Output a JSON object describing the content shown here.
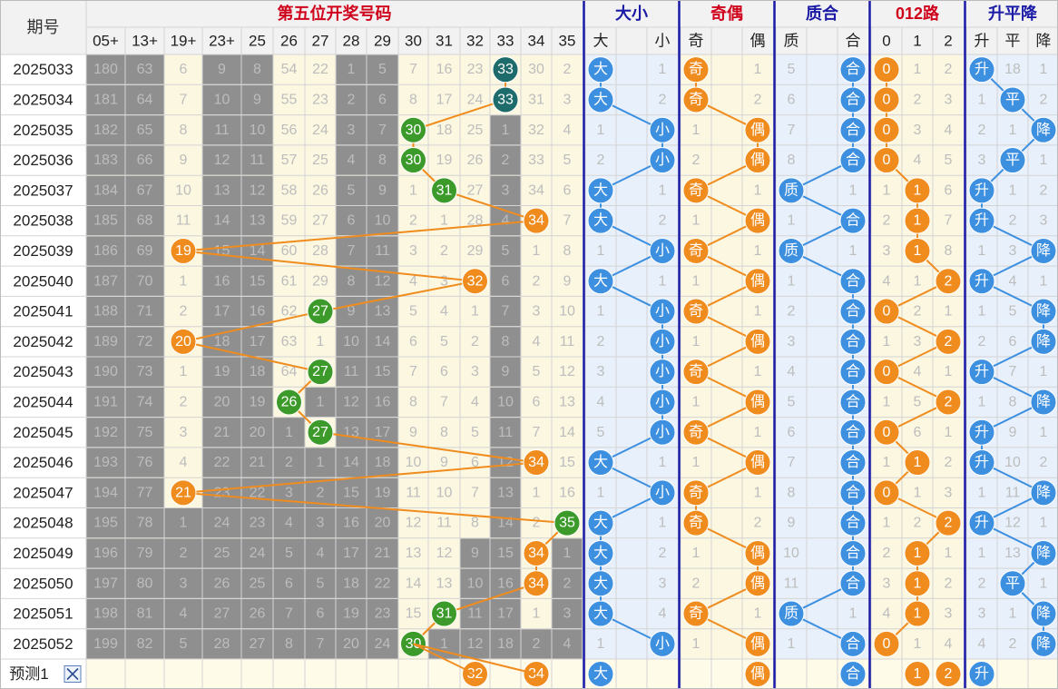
{
  "header": {
    "period_label": "期号",
    "groups": [
      {
        "key": "fifth",
        "label": "第五位开奖号码",
        "color": "#d0021b"
      },
      {
        "key": "bigsmall",
        "label": "大小",
        "color": "#1a1aa6"
      },
      {
        "key": "oddeven",
        "label": "奇偶",
        "color": "#d0021b"
      },
      {
        "key": "primecomp",
        "label": "质合",
        "color": "#1a1aa6"
      },
      {
        "key": "route012",
        "label": "012路",
        "color": "#d0021b"
      },
      {
        "key": "trend",
        "label": "升平降",
        "color": "#1a1aa6"
      }
    ],
    "sub": {
      "fifth": [
        "05+",
        "13+",
        "19+",
        "23+",
        "25",
        "26",
        "27",
        "28",
        "29",
        "30",
        "31",
        "32",
        "33",
        "34",
        "35"
      ],
      "bigsmall": [
        "大",
        "",
        "小"
      ],
      "oddeven": [
        "奇",
        "",
        "偶"
      ],
      "primecomp": [
        "质",
        "",
        "合"
      ],
      "route012": [
        "0",
        "1",
        "2"
      ],
      "trend": [
        "升",
        "平",
        "降"
      ]
    }
  },
  "colors": {
    "blue": "#3d8fe0",
    "orange": "#f08c1e",
    "green": "#3c9a2a",
    "teal": "#1d6b6b",
    "grey": "#8f8f8f",
    "cream": "#fbf7e0",
    "lightblue": "#e8f1fb",
    "line_blue": "#3d8fe0",
    "line_orange": "#f08c1e"
  },
  "footer": {
    "label": "预测1",
    "close_icon": "close-icon"
  },
  "chart_data": {
    "type": "table",
    "columns": [
      "期号",
      "05+",
      "13+",
      "19+",
      "23+",
      "25",
      "26",
      "27",
      "28",
      "29",
      "30",
      "31",
      "32",
      "33",
      "34",
      "35",
      "大",
      "小",
      "奇",
      "偶",
      "质",
      "合",
      "0",
      "1",
      "2",
      "升",
      "平",
      "降"
    ],
    "rows": [
      {
        "period": "2025033",
        "num": 33,
        "cells": [
          "180",
          "63",
          "6",
          "9",
          "8",
          "54",
          "22",
          "1",
          "5",
          "7",
          "16",
          "23",
          "33",
          "30",
          "2"
        ],
        "bs": [
          "大",
          "",
          "1"
        ],
        "oe": [
          "奇",
          "",
          "1"
        ],
        "pc": [
          "5",
          "",
          "合"
        ],
        "r": [
          "0",
          "1",
          "2"
        ],
        "t": [
          "升",
          "18",
          "1"
        ]
      },
      {
        "period": "2025034",
        "num": 33,
        "cells": [
          "181",
          "64",
          "7",
          "10",
          "9",
          "55",
          "23",
          "2",
          "6",
          "8",
          "17",
          "24",
          "33",
          "31",
          "3"
        ],
        "bs": [
          "大",
          "",
          "2"
        ],
        "oe": [
          "奇",
          "",
          "2"
        ],
        "pc": [
          "6",
          "",
          "合"
        ],
        "r": [
          "0",
          "2",
          "3"
        ],
        "t": [
          "1",
          "平",
          "2"
        ]
      },
      {
        "period": "2025035",
        "num": 30,
        "cells": [
          "182",
          "65",
          "8",
          "11",
          "10",
          "56",
          "24",
          "3",
          "7",
          "30",
          "18",
          "25",
          "1",
          "32",
          "4"
        ],
        "bs": [
          "1",
          "",
          "小"
        ],
        "oe": [
          "1",
          "",
          "偶"
        ],
        "pc": [
          "7",
          "",
          "合"
        ],
        "r": [
          "0",
          "3",
          "4"
        ],
        "t": [
          "2",
          "1",
          "降"
        ]
      },
      {
        "period": "2025036",
        "num": 30,
        "cells": [
          "183",
          "66",
          "9",
          "12",
          "11",
          "57",
          "25",
          "4",
          "8",
          "30",
          "19",
          "26",
          "2",
          "33",
          "5"
        ],
        "bs": [
          "2",
          "",
          "小"
        ],
        "oe": [
          "2",
          "",
          "偶"
        ],
        "pc": [
          "8",
          "",
          "合"
        ],
        "r": [
          "0",
          "4",
          "5"
        ],
        "t": [
          "3",
          "平",
          "1"
        ]
      },
      {
        "period": "2025037",
        "num": 31,
        "cells": [
          "184",
          "67",
          "10",
          "13",
          "12",
          "58",
          "26",
          "5",
          "9",
          "1",
          "31",
          "27",
          "3",
          "34",
          "6"
        ],
        "bs": [
          "大",
          "",
          "1"
        ],
        "oe": [
          "奇",
          "",
          "1"
        ],
        "pc": [
          "质",
          "",
          "1"
        ],
        "r": [
          "1",
          "1",
          "6"
        ],
        "t": [
          "升",
          "1",
          "2"
        ]
      },
      {
        "period": "2025038",
        "num": 34,
        "cells": [
          "185",
          "68",
          "11",
          "14",
          "13",
          "59",
          "27",
          "6",
          "10",
          "2",
          "1",
          "28",
          "4",
          "34",
          "7"
        ],
        "bs": [
          "大",
          "",
          "2"
        ],
        "oe": [
          "1",
          "",
          "偶"
        ],
        "pc": [
          "1",
          "",
          "合"
        ],
        "r": [
          "2",
          "1",
          "7"
        ],
        "t": [
          "升",
          "2",
          "3"
        ]
      },
      {
        "period": "2025039",
        "num": 19,
        "cells": [
          "186",
          "69",
          "19",
          "15",
          "14",
          "60",
          "28",
          "7",
          "11",
          "3",
          "2",
          "29",
          "5",
          "1",
          "8"
        ],
        "bs": [
          "1",
          "",
          "小"
        ],
        "oe": [
          "奇",
          "",
          "1"
        ],
        "pc": [
          "质",
          "",
          "1"
        ],
        "r": [
          "3",
          "1",
          "8"
        ],
        "t": [
          "1",
          "3",
          "降"
        ]
      },
      {
        "period": "2025040",
        "num": 32,
        "cells": [
          "187",
          "70",
          "1",
          "16",
          "15",
          "61",
          "29",
          "8",
          "12",
          "4",
          "3",
          "32",
          "6",
          "2",
          "9"
        ],
        "bs": [
          "大",
          "",
          "1"
        ],
        "oe": [
          "1",
          "",
          "偶"
        ],
        "pc": [
          "1",
          "",
          "合"
        ],
        "r": [
          "4",
          "1",
          "2"
        ],
        "t": [
          "升",
          "4",
          "1"
        ]
      },
      {
        "period": "2025041",
        "num": 27,
        "cells": [
          "188",
          "71",
          "2",
          "17",
          "16",
          "62",
          "27",
          "9",
          "13",
          "5",
          "4",
          "1",
          "7",
          "3",
          "10"
        ],
        "bs": [
          "1",
          "",
          "小"
        ],
        "oe": [
          "奇",
          "",
          "1"
        ],
        "pc": [
          "2",
          "",
          "合"
        ],
        "r": [
          "0",
          "2",
          "1"
        ],
        "t": [
          "1",
          "5",
          "降"
        ]
      },
      {
        "period": "2025042",
        "num": 20,
        "cells": [
          "189",
          "72",
          "20",
          "18",
          "17",
          "63",
          "1",
          "10",
          "14",
          "6",
          "5",
          "2",
          "8",
          "4",
          "11"
        ],
        "bs": [
          "2",
          "",
          "小"
        ],
        "oe": [
          "1",
          "",
          "偶"
        ],
        "pc": [
          "3",
          "",
          "合"
        ],
        "r": [
          "1",
          "3",
          "2"
        ],
        "t": [
          "2",
          "6",
          "降"
        ]
      },
      {
        "period": "2025043",
        "num": 27,
        "cells": [
          "190",
          "73",
          "1",
          "19",
          "18",
          "64",
          "27",
          "11",
          "15",
          "7",
          "6",
          "3",
          "9",
          "5",
          "12"
        ],
        "bs": [
          "3",
          "",
          "小"
        ],
        "oe": [
          "奇",
          "",
          "1"
        ],
        "pc": [
          "4",
          "",
          "合"
        ],
        "r": [
          "0",
          "4",
          "1"
        ],
        "t": [
          "升",
          "7",
          "1"
        ]
      },
      {
        "period": "2025044",
        "num": 26,
        "cells": [
          "191",
          "74",
          "2",
          "20",
          "19",
          "26",
          "1",
          "12",
          "16",
          "8",
          "7",
          "4",
          "10",
          "6",
          "13"
        ],
        "bs": [
          "4",
          "",
          "小"
        ],
        "oe": [
          "1",
          "",
          "偶"
        ],
        "pc": [
          "5",
          "",
          "合"
        ],
        "r": [
          "1",
          "5",
          "2"
        ],
        "t": [
          "1",
          "8",
          "降"
        ]
      },
      {
        "period": "2025045",
        "num": 27,
        "cells": [
          "192",
          "75",
          "3",
          "21",
          "20",
          "1",
          "27",
          "13",
          "17",
          "9",
          "8",
          "5",
          "11",
          "7",
          "14"
        ],
        "bs": [
          "5",
          "",
          "小"
        ],
        "oe": [
          "奇",
          "",
          "1"
        ],
        "pc": [
          "6",
          "",
          "合"
        ],
        "r": [
          "0",
          "6",
          "1"
        ],
        "t": [
          "升",
          "9",
          "1"
        ]
      },
      {
        "period": "2025046",
        "num": 34,
        "cells": [
          "193",
          "76",
          "4",
          "22",
          "21",
          "2",
          "1",
          "14",
          "18",
          "10",
          "9",
          "6",
          "12",
          "34",
          "15"
        ],
        "bs": [
          "大",
          "",
          "1"
        ],
        "oe": [
          "1",
          "",
          "偶"
        ],
        "pc": [
          "7",
          "",
          "合"
        ],
        "r": [
          "1",
          "1",
          "2"
        ],
        "t": [
          "升",
          "10",
          "2"
        ]
      },
      {
        "period": "2025047",
        "num": 21,
        "cells": [
          "194",
          "77",
          "21",
          "23",
          "22",
          "3",
          "2",
          "15",
          "19",
          "11",
          "10",
          "7",
          "13",
          "1",
          "16"
        ],
        "bs": [
          "1",
          "",
          "小"
        ],
        "oe": [
          "奇",
          "",
          "1"
        ],
        "pc": [
          "8",
          "",
          "合"
        ],
        "r": [
          "0",
          "1",
          "3"
        ],
        "t": [
          "1",
          "11",
          "降"
        ]
      },
      {
        "period": "2025048",
        "num": 35,
        "cells": [
          "195",
          "78",
          "1",
          "24",
          "23",
          "4",
          "3",
          "16",
          "20",
          "12",
          "11",
          "8",
          "14",
          "2",
          "35"
        ],
        "bs": [
          "大",
          "",
          "1"
        ],
        "oe": [
          "奇",
          "",
          "2"
        ],
        "pc": [
          "9",
          "",
          "合"
        ],
        "r": [
          "1",
          "2",
          "2"
        ],
        "t": [
          "升",
          "12",
          "1"
        ]
      },
      {
        "period": "2025049",
        "num": 34,
        "cells": [
          "196",
          "79",
          "2",
          "25",
          "24",
          "5",
          "4",
          "17",
          "21",
          "13",
          "12",
          "9",
          "15",
          "34",
          "1"
        ],
        "bs": [
          "大",
          "",
          "2"
        ],
        "oe": [
          "1",
          "",
          "偶"
        ],
        "pc": [
          "10",
          "",
          "合"
        ],
        "r": [
          "2",
          "1",
          "1"
        ],
        "t": [
          "1",
          "13",
          "降"
        ]
      },
      {
        "period": "2025050",
        "num": 34,
        "cells": [
          "197",
          "80",
          "3",
          "26",
          "25",
          "6",
          "5",
          "18",
          "22",
          "14",
          "13",
          "10",
          "16",
          "34",
          "2"
        ],
        "bs": [
          "大",
          "",
          "3"
        ],
        "oe": [
          "2",
          "",
          "偶"
        ],
        "pc": [
          "11",
          "",
          "合"
        ],
        "r": [
          "3",
          "1",
          "2"
        ],
        "t": [
          "2",
          "平",
          "1"
        ]
      },
      {
        "period": "2025051",
        "num": 31,
        "cells": [
          "198",
          "81",
          "4",
          "27",
          "26",
          "7",
          "6",
          "19",
          "23",
          "15",
          "31",
          "11",
          "17",
          "1",
          "3"
        ],
        "bs": [
          "大",
          "",
          "4"
        ],
        "oe": [
          "奇",
          "",
          "1"
        ],
        "pc": [
          "质",
          "",
          "1"
        ],
        "r": [
          "4",
          "1",
          "3"
        ],
        "t": [
          "3",
          "1",
          "降"
        ]
      },
      {
        "period": "2025052",
        "num": 30,
        "cells": [
          "199",
          "82",
          "5",
          "28",
          "27",
          "8",
          "7",
          "20",
          "24",
          "30",
          "1",
          "12",
          "18",
          "2",
          "4"
        ],
        "bs": [
          "1",
          "",
          "小"
        ],
        "oe": [
          "1",
          "",
          "偶"
        ],
        "pc": [
          "1",
          "",
          "合"
        ],
        "r": [
          "0",
          "1",
          "4"
        ],
        "t": [
          "4",
          "2",
          "降"
        ]
      }
    ],
    "prediction": {
      "fifth": [
        "32",
        "34"
      ],
      "bs": "大",
      "oe": "偶",
      "pc": "合",
      "r": [
        "1",
        "2"
      ],
      "t": "升"
    }
  }
}
